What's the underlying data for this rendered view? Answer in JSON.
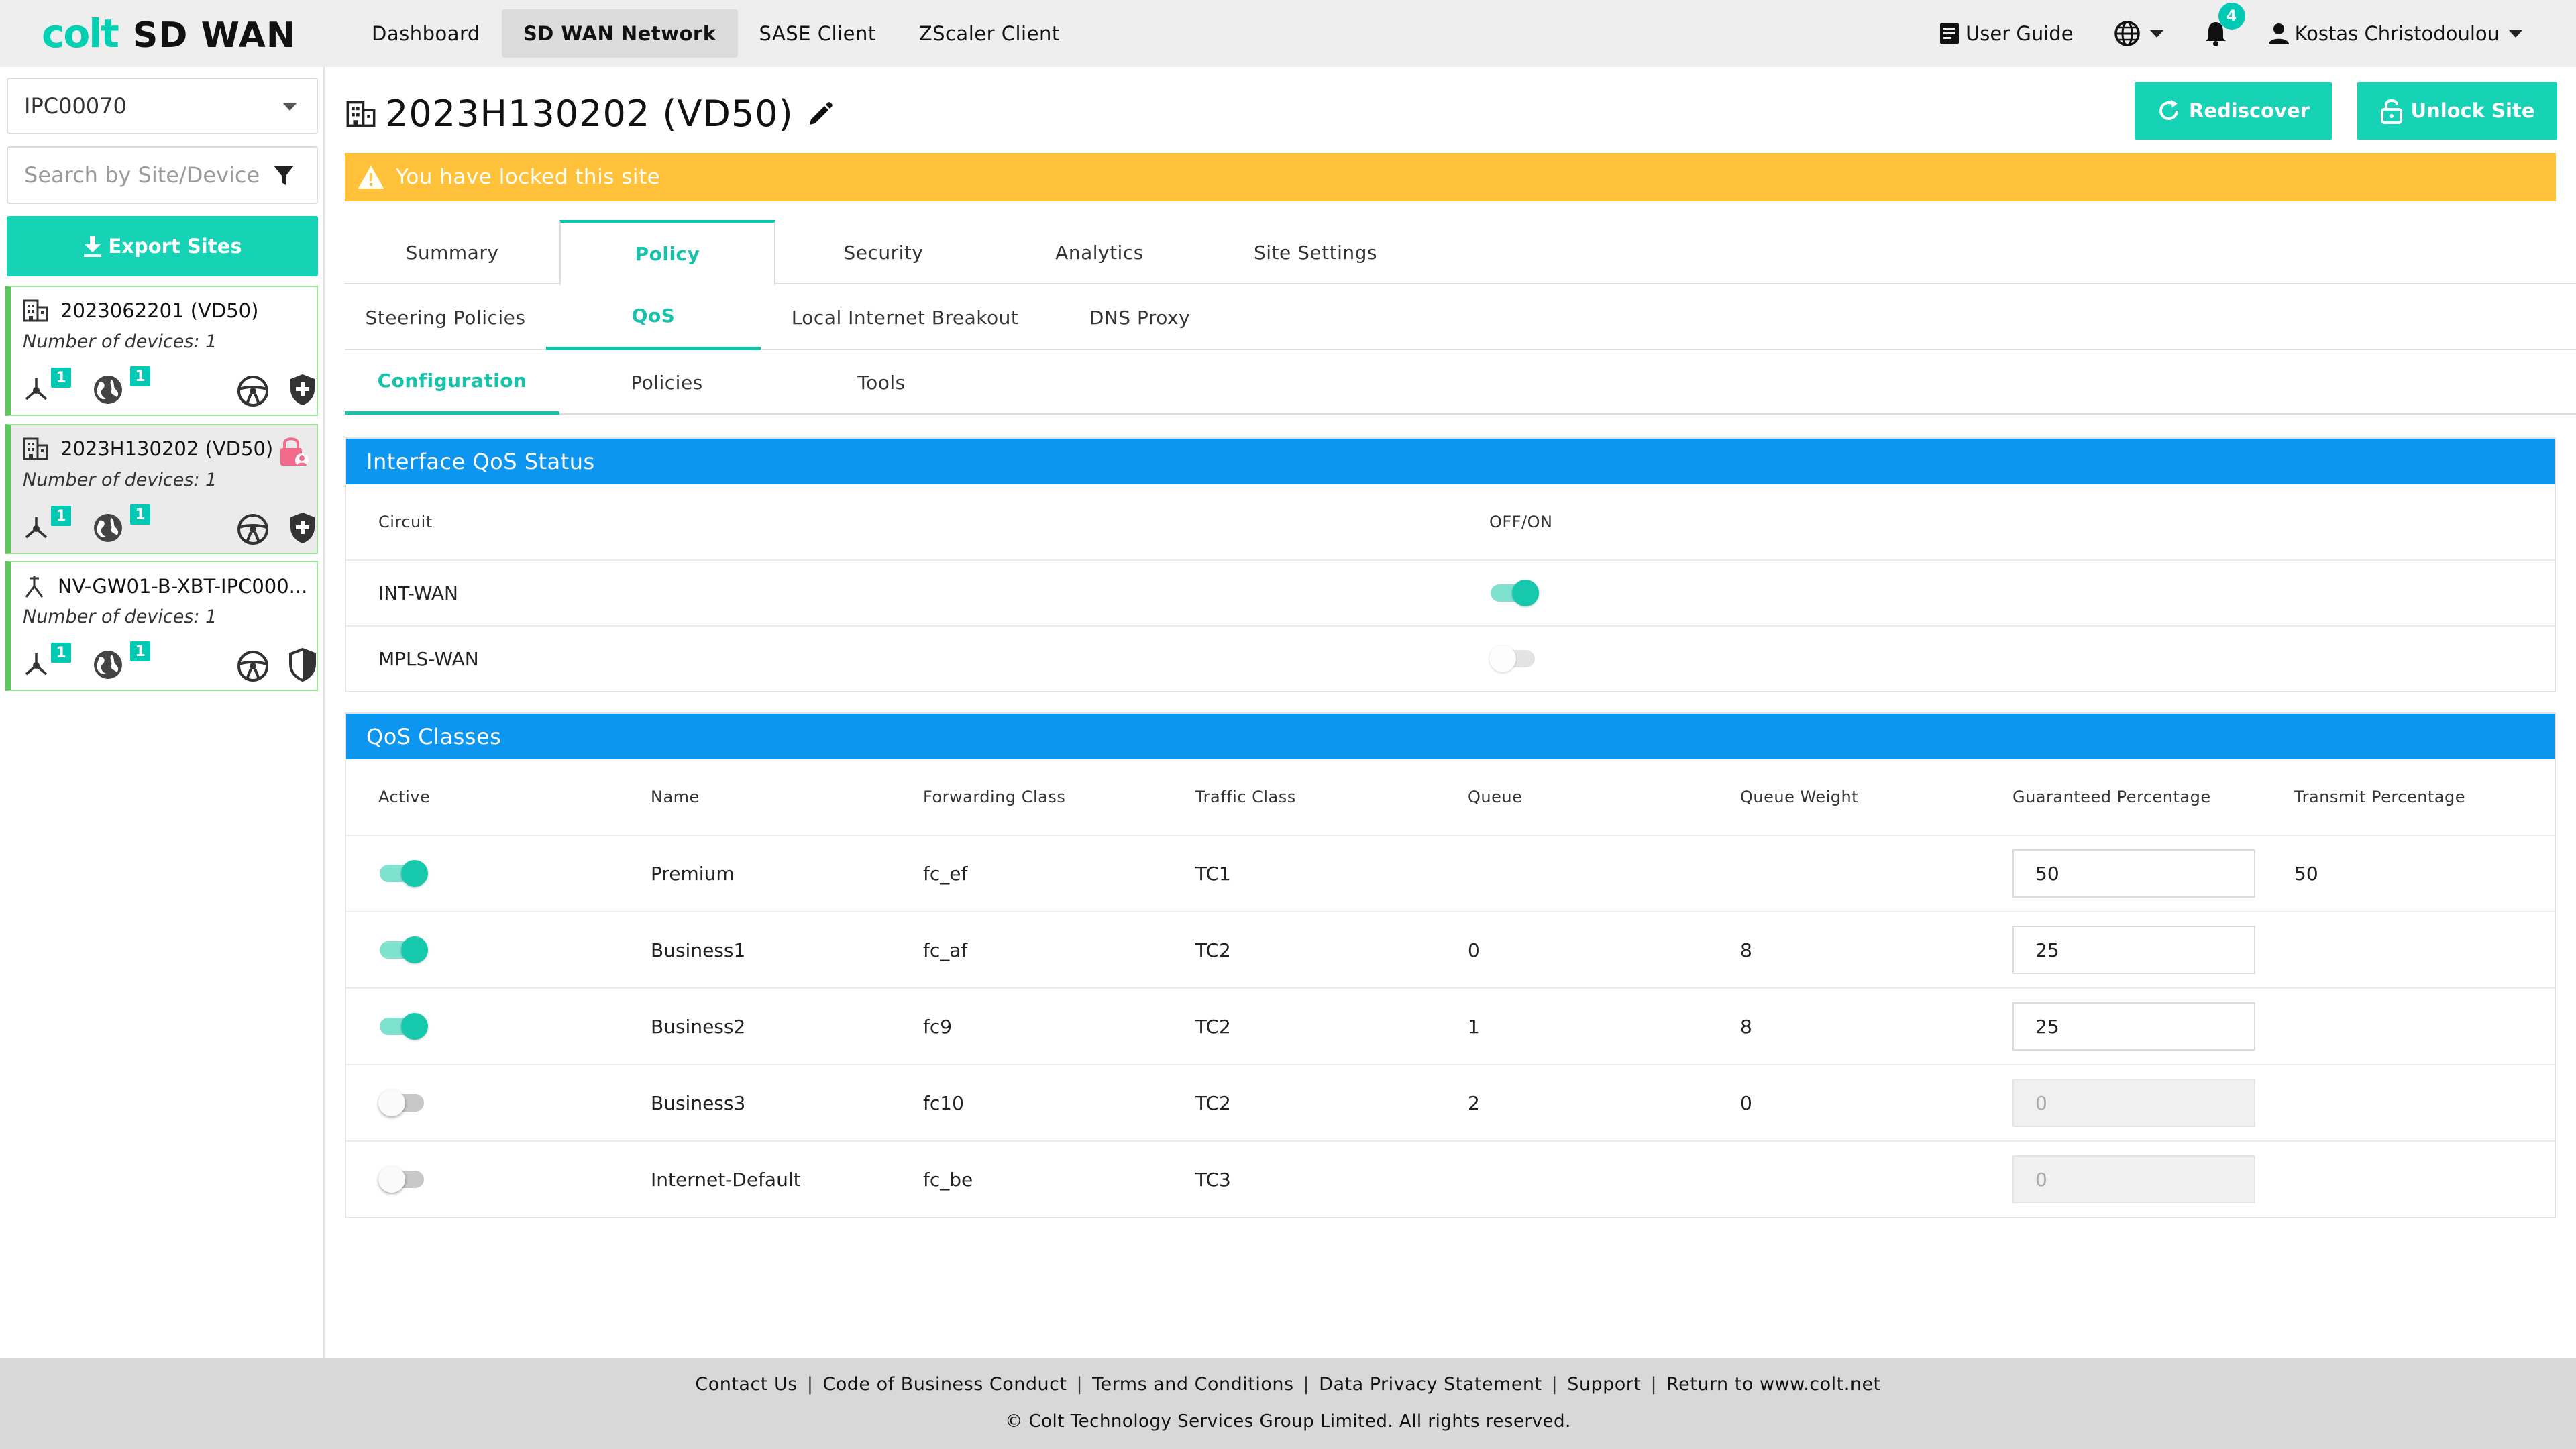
{
  "brand": {
    "logo_text": "colt",
    "product": "SD WAN"
  },
  "nav": {
    "links": [
      "Dashboard",
      "SD WAN Network",
      "SASE Client",
      "ZScaler Client"
    ],
    "active_index": 1,
    "user_guide": "User Guide",
    "notifications_count": "4",
    "user_name": "Kostas Christodoulou"
  },
  "sidebar": {
    "customer_select": "IPC00070",
    "search_placeholder": "Search by Site/Device",
    "export_label": "Export Sites",
    "sites": [
      {
        "name": "2023062201 (VD50)",
        "devices": "Number of devices: 1",
        "badge_a": "1",
        "badge_b": "1",
        "selected": false,
        "locked": false
      },
      {
        "name": "2023H130202 (VD50)",
        "devices": "Number of devices: 1",
        "badge_a": "1",
        "badge_b": "1",
        "selected": true,
        "locked": true
      },
      {
        "name": "NV-GW01-B-XBT-IPC000...",
        "devices": "Number of devices: 1",
        "badge_a": "1",
        "badge_b": "1",
        "selected": false,
        "locked": false
      }
    ]
  },
  "header": {
    "title": "2023H130202 (VD50)",
    "rediscover_label": "Rediscover",
    "unlock_label": "Unlock Site",
    "lock_banner": "You have locked this site"
  },
  "tabs_level1": [
    "Summary",
    "Policy",
    "Security",
    "Analytics",
    "Site Settings"
  ],
  "tabs_level2": [
    "Steering Policies",
    "QoS",
    "Local Internet Breakout",
    "DNS Proxy"
  ],
  "tabs_level3": [
    "Configuration",
    "Policies",
    "Tools"
  ],
  "interface_qos": {
    "title": "Interface QoS Status",
    "col_circuit": "Circuit",
    "col_onoff": "OFF/ON",
    "rows": [
      {
        "circuit": "INT-WAN",
        "on": true
      },
      {
        "circuit": "MPLS-WAN",
        "on": false
      }
    ]
  },
  "qos_classes": {
    "title": "QoS Classes",
    "headers": [
      "Active",
      "Name",
      "Forwarding Class",
      "Traffic Class",
      "Queue",
      "Queue Weight",
      "Guaranteed Percentage",
      "Transmit Percentage"
    ],
    "rows": [
      {
        "active": true,
        "name": "Premium",
        "fwd": "fc_ef",
        "tc": "TC1",
        "queue": "",
        "weight": "",
        "guaranteed": "50",
        "transmit": "50",
        "editable": true
      },
      {
        "active": true,
        "name": "Business1",
        "fwd": "fc_af",
        "tc": "TC2",
        "queue": "0",
        "weight": "8",
        "guaranteed": "25",
        "transmit": "",
        "editable": true
      },
      {
        "active": true,
        "name": "Business2",
        "fwd": "fc9",
        "tc": "TC2",
        "queue": "1",
        "weight": "8",
        "guaranteed": "25",
        "transmit": "",
        "editable": true
      },
      {
        "active": false,
        "name": "Business3",
        "fwd": "fc10",
        "tc": "TC2",
        "queue": "2",
        "weight": "0",
        "guaranteed": "0",
        "transmit": "",
        "editable": false
      },
      {
        "active": false,
        "name": "Internet-Default",
        "fwd": "fc_be",
        "tc": "TC3",
        "queue": "",
        "weight": "",
        "guaranteed": "0",
        "transmit": "",
        "editable": false
      }
    ]
  },
  "footer": {
    "links": [
      "Contact Us",
      "Code of Business Conduct",
      "Terms and Conditions",
      "Data Privacy Statement",
      "Support",
      "Return to www.colt.net"
    ],
    "copyright": "© Colt Technology Services Group Limited. All rights reserved."
  },
  "colors": {
    "accent": "#16d3b6",
    "panel_header": "#0d96f0",
    "warning": "#ffc23a",
    "site_border": "#5cc85c",
    "lock_icon": "#f26b8a"
  }
}
